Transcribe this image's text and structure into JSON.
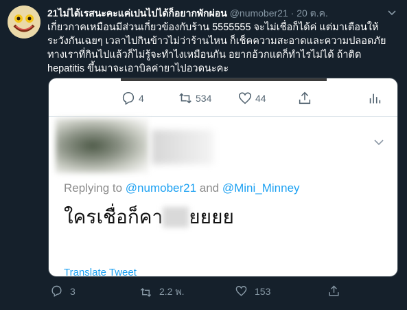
{
  "tweet": {
    "display_name": "21ไม่ได้เรสนะคะแค่เปนไปได้ก็อยากพักผ่อน",
    "handle": "@numober21",
    "separator": "·",
    "date": "20 ต.ค.",
    "text": "เกี่ยวกาคเหมือนมีส่วนเกี่ยวข้องกับร้าน 5555555 จะไม่เชื่อก็ได้ค่ ​แต่มาเตือนให้ระวังกันเฉยๆ เวลาไปกินข้าวไม่ว่าร้านไหน ก็เช็คความสะอาดและความปลอดภัย ทางเราที่กินไปแล้วก็ไม่รู้จะทำไงเหมือนกัน อยากอ้วกแดก็ทำไรไม่ได้ ถ้าติด hepatitis ขึ้นมาจะเอาบิลค่ายาไปอวดนะคะ",
    "actions": {
      "replies": "3",
      "retweets": "2.2 พ.",
      "likes": "153"
    }
  },
  "quoted_screenshot": {
    "actions": {
      "replies": "4",
      "retweets": "534",
      "likes": "44"
    },
    "replying_prefix": "Replying to ",
    "mention_1": "@numober21",
    "and_word": " and ",
    "mention_2": "@Mini_Minney",
    "text_start": "ใครเชื่อก็คา",
    "text_end": "ยยยย",
    "translate_label": "Translate Tweet"
  },
  "icons": {
    "reply": "reply-icon",
    "retweet": "retweet-icon",
    "like": "heart-icon",
    "share": "share-icon",
    "analytics": "analytics-icon",
    "more": "chevron-down-icon"
  },
  "colors": {
    "background": "#15202b",
    "secondary_text": "#8899a6",
    "link": "#1da1f2"
  }
}
